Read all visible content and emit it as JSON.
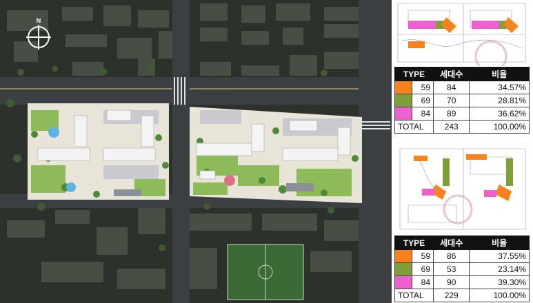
{
  "compass": {
    "label": "N"
  },
  "swatch_colors": {
    "orange": "#f7821e",
    "green": "#7f9f3a",
    "pink": "#ee5fcf"
  },
  "tables": [
    {
      "headers": {
        "type": "TYPE",
        "units": "세대수",
        "ratio": "비율"
      },
      "rows": [
        {
          "color": "#f7821e",
          "type": "59",
          "units": "84",
          "ratio": "34.57%"
        },
        {
          "color": "#7f9f3a",
          "type": "69",
          "units": "70",
          "ratio": "28.81%"
        },
        {
          "color": "#ee5fcf",
          "type": "84",
          "units": "89",
          "ratio": "36.62%"
        }
      ],
      "total": {
        "label": "TOTAL",
        "units": "243",
        "ratio": "100.00%"
      }
    },
    {
      "headers": {
        "type": "TYPE",
        "units": "세대수",
        "ratio": "비율"
      },
      "rows": [
        {
          "color": "#f7821e",
          "type": "59",
          "units": "86",
          "ratio": "37.55%"
        },
        {
          "color": "#7f9f3a",
          "type": "69",
          "units": "53",
          "ratio": "23.14%"
        },
        {
          "color": "#ee5fcf",
          "type": "84",
          "units": "90",
          "ratio": "39.30%"
        }
      ],
      "total": {
        "label": "TOTAL",
        "units": "229",
        "ratio": "100.00%"
      }
    }
  ]
}
